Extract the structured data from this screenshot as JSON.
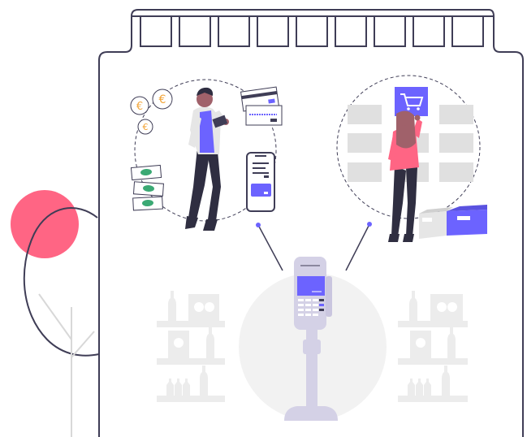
{
  "illustration": {
    "subject": "store-checkout-payment-terminal",
    "colors": {
      "outline": "#3f3d56",
      "accent": "#6c63ff",
      "pink": "#ff6584",
      "light_gray": "#e6e6e6",
      "mid_gray": "#dcdcdc",
      "terminal": "#d4d1e6",
      "skin": "#a0616a",
      "hair": "#2f2e41",
      "euro": "#f2a53a",
      "banknote": "#3ba974"
    },
    "icons": [
      "euro-coin-icon",
      "banknote-icon",
      "credit-card-icon",
      "smartphone-icon",
      "shopping-cart-icon",
      "payment-terminal-icon",
      "bottle-icon"
    ],
    "window_count": 9
  }
}
